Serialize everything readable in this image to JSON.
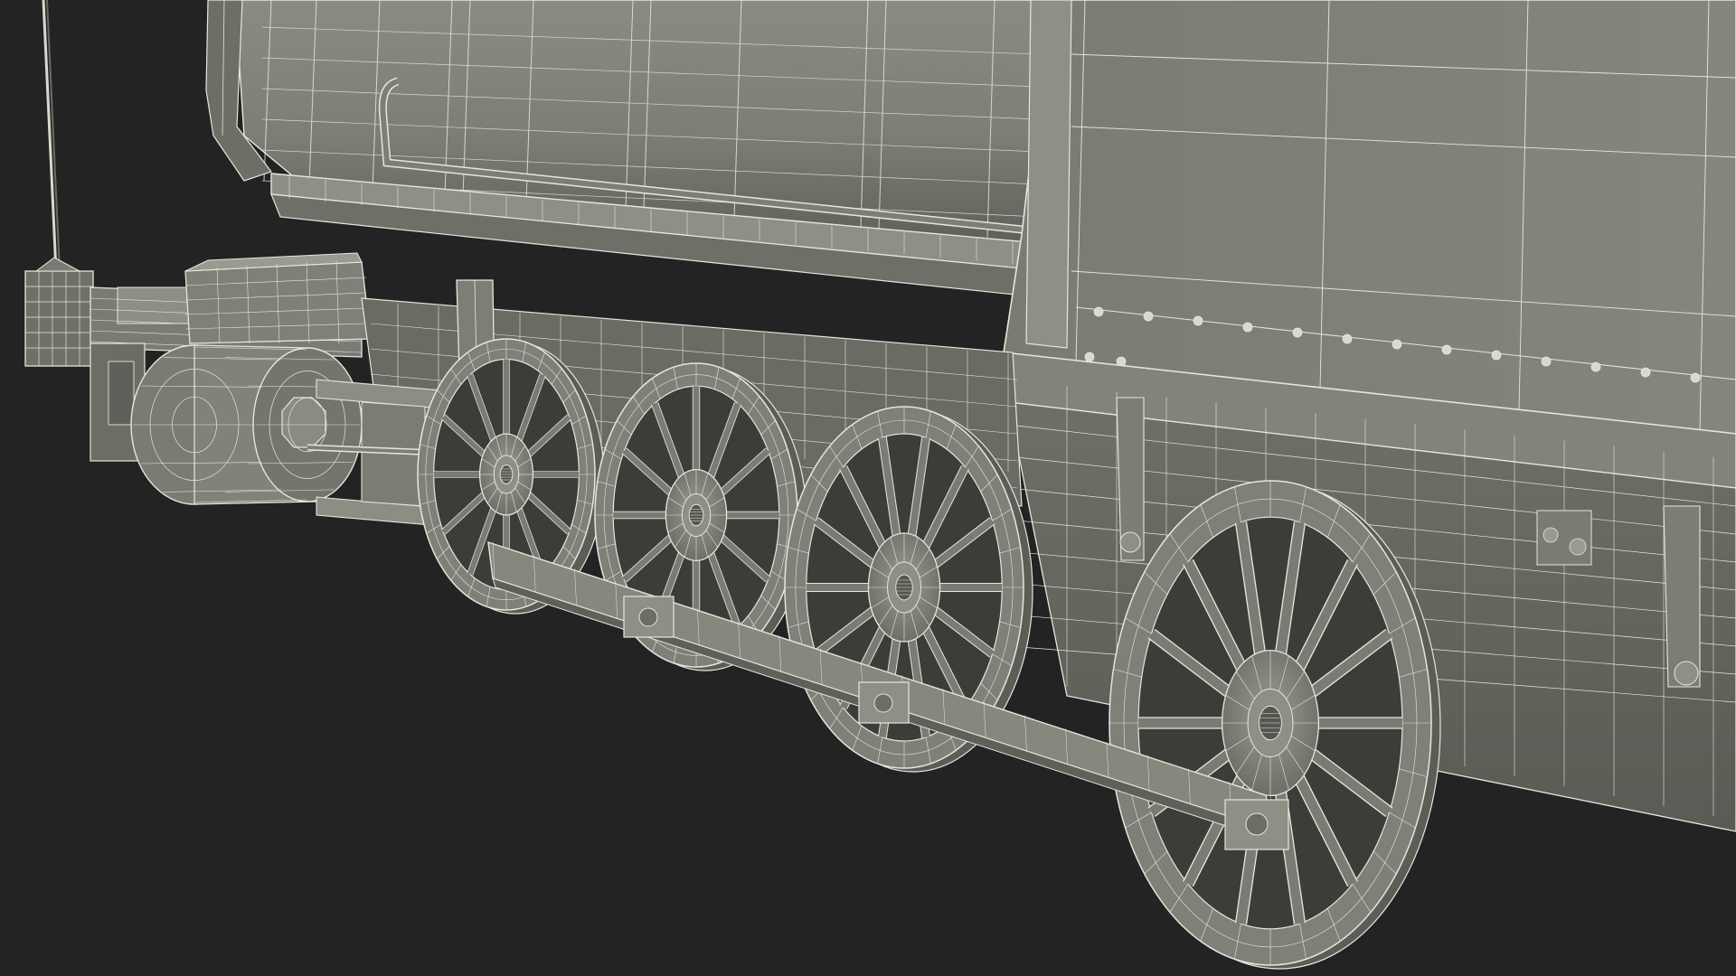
{
  "scene": {
    "subject": "steam-locomotive-wireframe",
    "background_color": "#232323",
    "surface_color": "#7b7c72",
    "surface_shade_color": "#5e5f57",
    "surface_light_color": "#96978d",
    "wire_color": "#e6e6dd"
  }
}
